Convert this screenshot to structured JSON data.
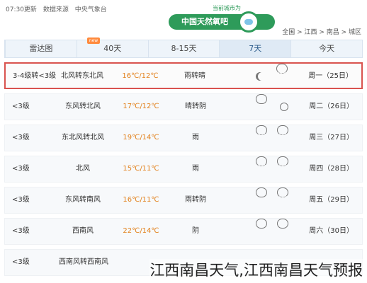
{
  "header": {
    "source_time": "07:30更新",
    "source_data": "数据来源",
    "source_org": "中央气象台",
    "logo_text": "中国天然氧吧",
    "logo_caption": "当前城市为",
    "breadcrumb": "全国 > 江西 > 南昌 > 城区"
  },
  "tabs": [
    {
      "label": "今天"
    },
    {
      "label": "7天"
    },
    {
      "label": "8-15天"
    },
    {
      "label": "40天",
      "badge": "new"
    },
    {
      "label": "雷达图"
    }
  ],
  "forecast": [
    {
      "day": "周一（25日）",
      "icons": [
        "rain-icon",
        "moon-icon"
      ],
      "cond": "雨转晴",
      "temp": "16℃/12℃",
      "wind": "北风转东北风",
      "level": "3-4级转<3级"
    },
    {
      "day": "周二（26日）",
      "icons": [
        "sun-icon",
        "cloud-icon"
      ],
      "cond": "晴转阴",
      "temp": "17℃/12℃",
      "wind": "东风转北风",
      "level": "<3级"
    },
    {
      "day": "周三（27日）",
      "icons": [
        "rain-icon",
        "rain-icon"
      ],
      "cond": "雨",
      "temp": "19℃/14℃",
      "wind": "东北风转北风",
      "level": "<3级"
    },
    {
      "day": "周四（28日）",
      "icons": [
        "rain-icon",
        "rain-icon"
      ],
      "cond": "雨",
      "temp": "15℃/11℃",
      "wind": "北风",
      "level": "<3级"
    },
    {
      "day": "周五（29日）",
      "icons": [
        "rain-icon",
        "cloud-icon"
      ],
      "cond": "雨转阴",
      "temp": "16℃/11℃",
      "wind": "东风转南风",
      "level": "<3级"
    },
    {
      "day": "周六（30日）",
      "icons": [
        "cloud-icon",
        "cloud-icon"
      ],
      "cond": "阴",
      "temp": "22℃/14℃",
      "wind": "西南风",
      "level": "<3级"
    },
    {
      "day": "",
      "icons": [],
      "cond": "",
      "temp": "",
      "wind": "西南风转西南风",
      "level": "<3级"
    }
  ],
  "caption": "江西南昌天气,江西南昌天气预报",
  "colors": {
    "accent": "#2e9b5a",
    "highlight": "#d9534f",
    "temp": "#e2811c"
  }
}
